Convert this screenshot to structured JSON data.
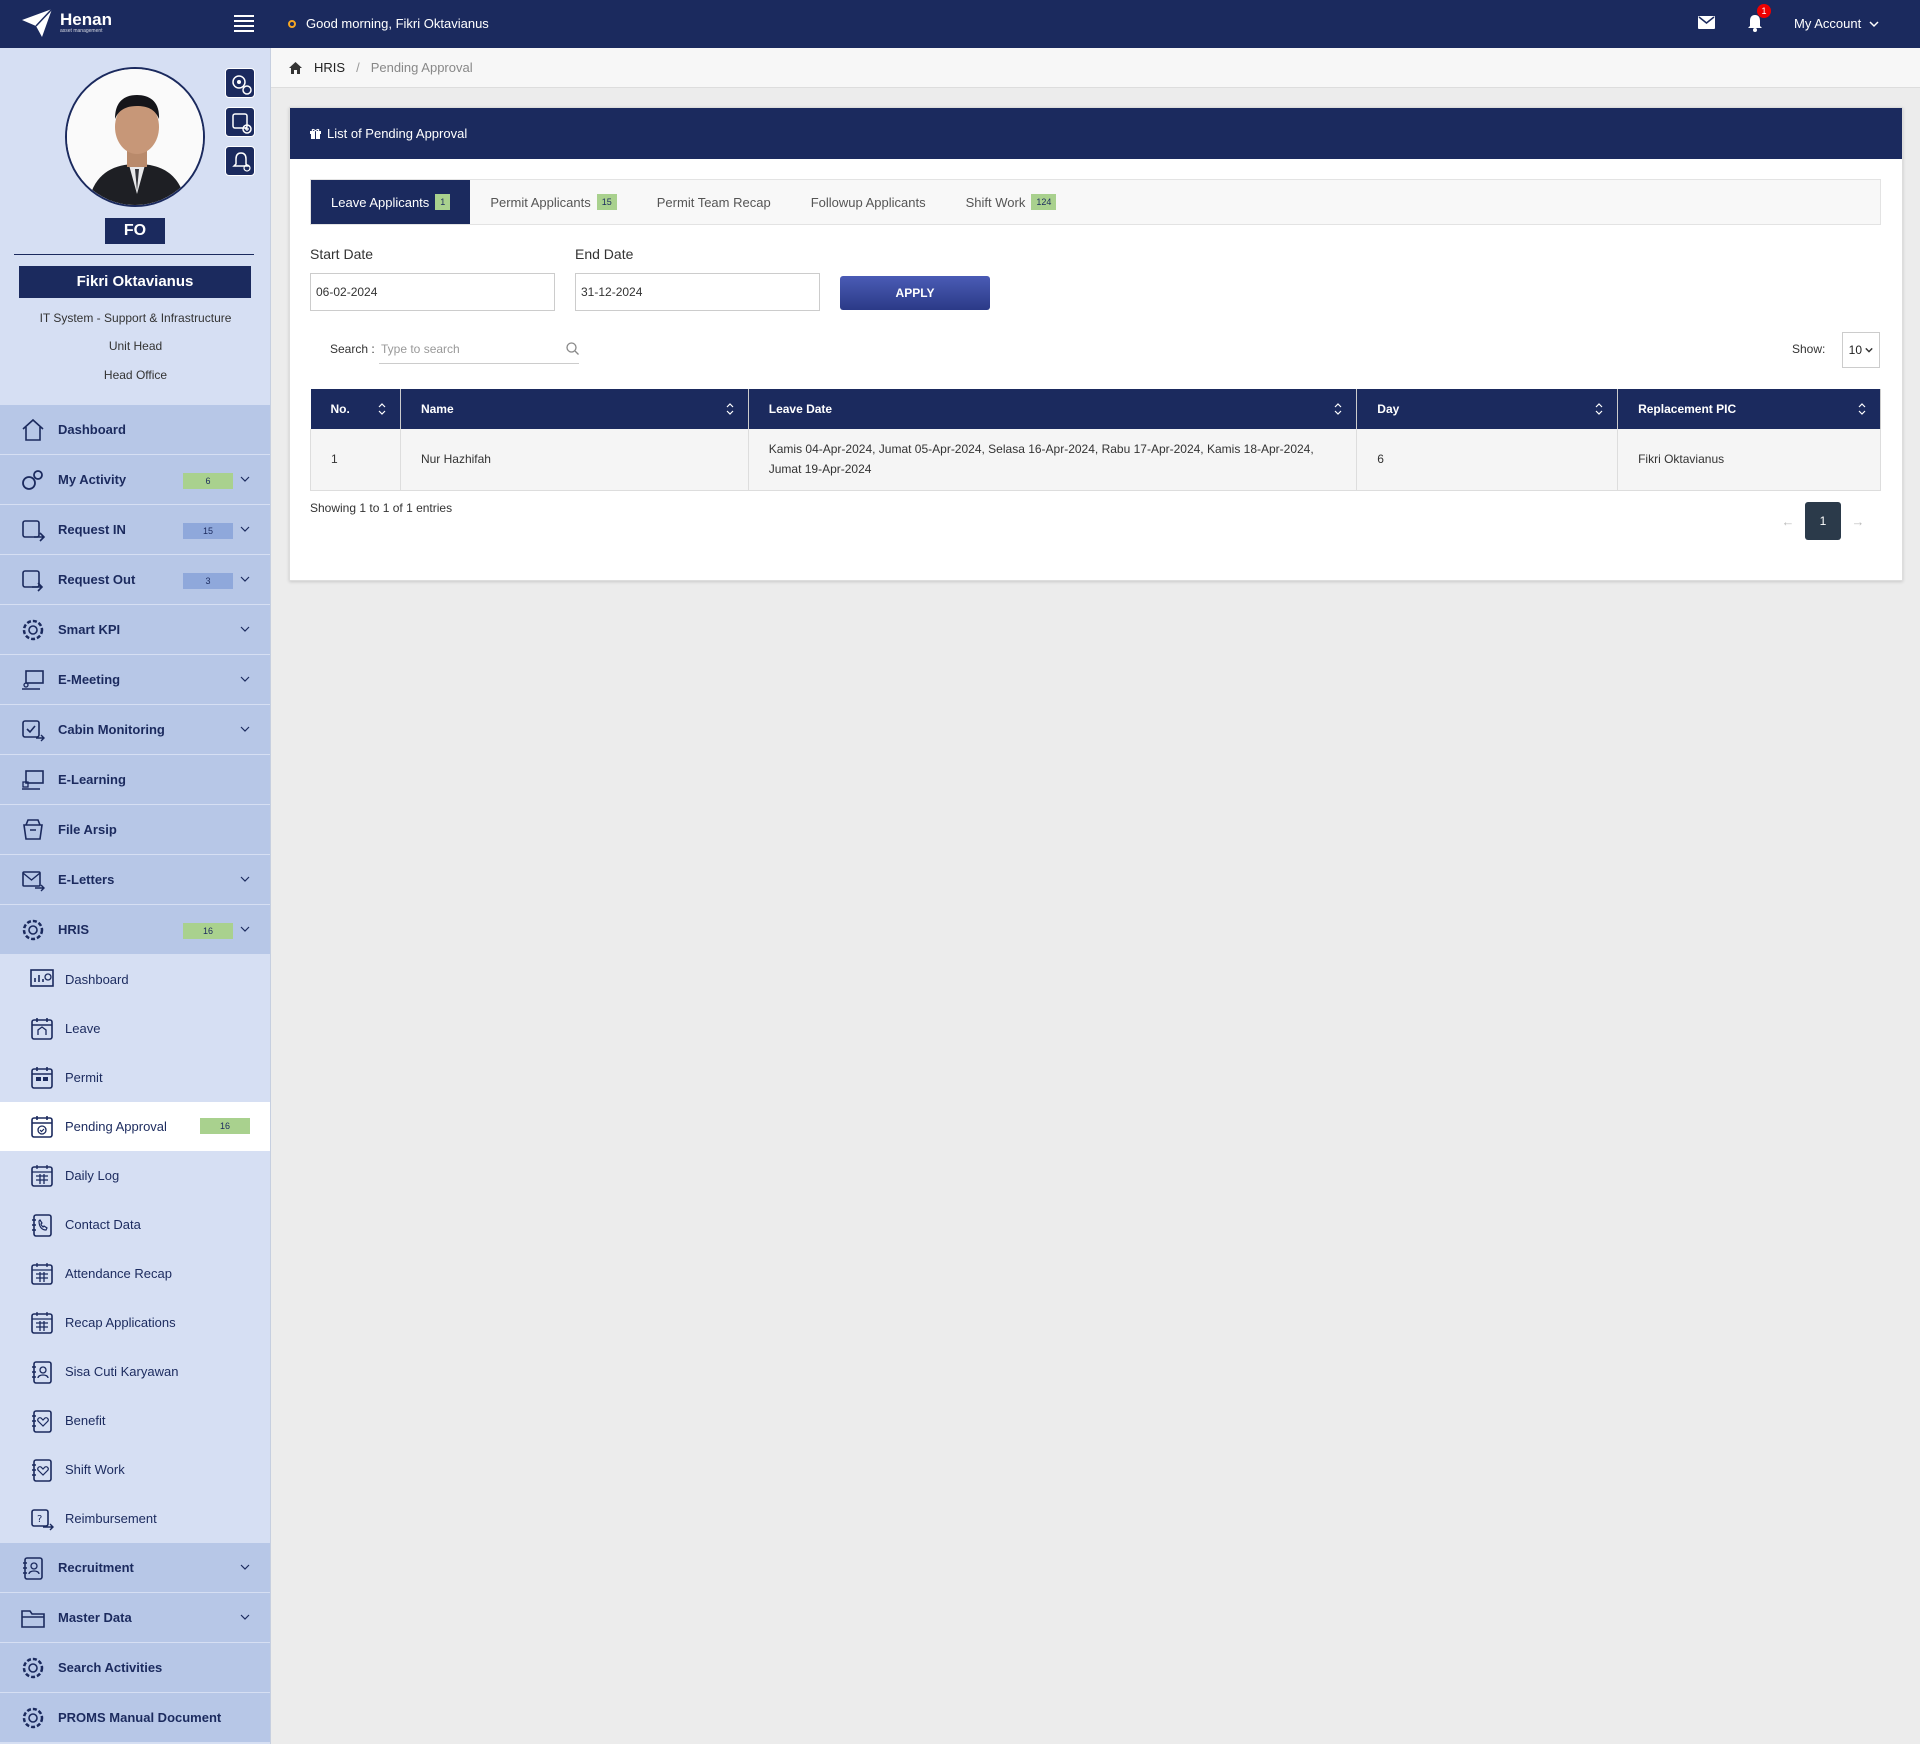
{
  "topbar": {
    "brand": "Henan",
    "brand_sub": "asset management",
    "greeting": "Good morning, Fikri Oktavianus",
    "notification_count": "1",
    "account_label": "My Account"
  },
  "profile": {
    "initials": "FO",
    "name": "Fikri Oktavianus",
    "department": "IT System - Support & Infrastructure",
    "position": "Unit Head",
    "location": "Head Office"
  },
  "menu": {
    "dashboard": "Dashboard",
    "my_activity": "My Activity",
    "my_activity_badge": "6",
    "request_in": "Request IN",
    "request_in_badge": "15",
    "request_out": "Request Out",
    "request_out_badge": "3",
    "smart_kpi": "Smart KPI",
    "e_meeting": "E-Meeting",
    "cabin_monitoring": "Cabin Monitoring",
    "e_learning": "E-Learning",
    "file_arsip": "File Arsip",
    "e_letters": "E-Letters",
    "hris": "HRIS",
    "hris_badge": "16",
    "hris_sub": {
      "dashboard": "Dashboard",
      "leave": "Leave",
      "permit": "Permit",
      "pending_approval": "Pending Approval",
      "pending_approval_badge": "16",
      "daily_log": "Daily Log",
      "contact_data": "Contact Data",
      "attendance_recap": "Attendance Recap",
      "recap_applications": "Recap Applications",
      "sisa_cuti": "Sisa Cuti Karyawan",
      "benefit": "Benefit",
      "shift_work": "Shift Work",
      "reimbursement": "Reimbursement"
    },
    "recruitment": "Recruitment",
    "master_data": "Master Data",
    "search_activities": "Search Activities",
    "proms_manual": "PROMS Manual Document"
  },
  "breadcrumb": {
    "root": "HRIS",
    "current": "Pending Approval"
  },
  "card": {
    "title": "List of Pending Approval",
    "tabs": [
      {
        "label": "Leave Applicants",
        "badge": "1"
      },
      {
        "label": "Permit Applicants",
        "badge": "15"
      },
      {
        "label": "Permit Team Recap"
      },
      {
        "label": "Followup Applicants"
      },
      {
        "label": "Shift Work",
        "badge": "124"
      }
    ],
    "start_date_label": "Start Date",
    "start_date_value": "06-02-2024",
    "end_date_label": "End Date",
    "end_date_value": "31-12-2024",
    "apply_label": "APPLY",
    "search_label": "Search :",
    "search_placeholder": "Type to search",
    "show_label": "Show:",
    "show_value": "10",
    "columns": [
      "No.",
      "Name",
      "Leave Date",
      "Day",
      "Replacement PIC"
    ],
    "rows": [
      {
        "no": "1",
        "name": "Nur Hazhifah",
        "leave_date": "Kamis 04-Apr-2024, Jumat 05-Apr-2024, Selasa 16-Apr-2024, Rabu 17-Apr-2024, Kamis 18-Apr-2024, Jumat 19-Apr-2024",
        "day": "6",
        "replacement": "Fikri Oktavianus"
      }
    ],
    "showing": "Showing 1 to 1 of 1 entries",
    "page_prev": "←",
    "page_current": "1",
    "page_next": "→"
  },
  "colors": {
    "primary": "#1b2a5e",
    "sidebar_bg": "#d6dff3",
    "menu_bg": "#b7c7e7",
    "badge_green": "#a9d18e",
    "badge_blue": "#8fa8db"
  }
}
